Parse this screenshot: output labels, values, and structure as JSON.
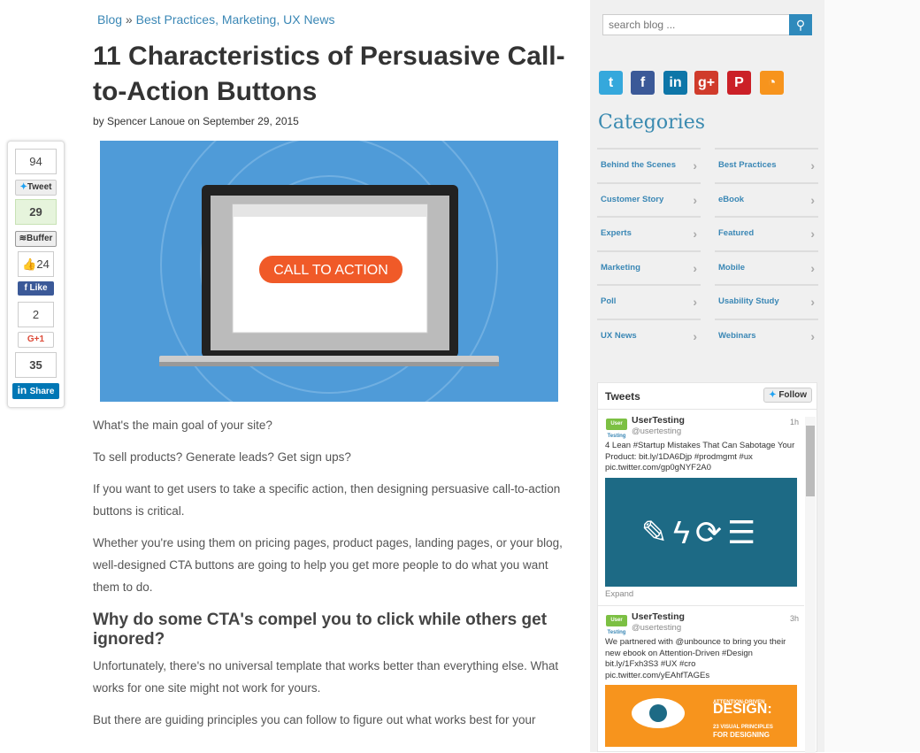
{
  "breadcrumb": {
    "root": "Blog",
    "sep": "»",
    "categories": "Best Practices, Marketing, UX News"
  },
  "article": {
    "title": "11 Characteristics of Persuasive Call-to-Action Buttons",
    "byline": "by Spencer Lanoue on September 29, 2015",
    "hero_cta": "CALL TO ACTION",
    "paragraphs": [
      "What's the main goal of your site?",
      "To sell products? Generate leads? Get sign ups?",
      "If you want to get users to take a specific action, then designing persuasive call-to-action buttons is critical.",
      "Whether you're using them on pricing pages, product pages, landing pages, or your blog, well-designed CTA buttons are going to help you get more people to do what you want them to do."
    ],
    "heading": "Why do some CTA's compel you to click while others get ignored?",
    "paragraphs2": [
      "Unfortunately, there's no universal template that works better than everything else. What works for one site might not work for yours.",
      "But there are guiding principles you can follow to figure out what works best for your"
    ]
  },
  "share": {
    "tweet_count": "94",
    "tweet_label": "Tweet",
    "buffer_count": "29",
    "buffer_label": "Buffer",
    "like_count": "24",
    "like_label": "Like",
    "gplus_count": "2",
    "gplus_label": "G+1",
    "linkedin_count": "35",
    "linkedin_label": "Share"
  },
  "sidebar": {
    "search_placeholder": "search blog ...",
    "social": [
      "twitter",
      "facebook",
      "linkedin",
      "google-plus",
      "pinterest",
      "rss"
    ],
    "categories_title": "Categories",
    "categories": [
      "Behind the Scenes",
      "Best Practices",
      "Customer Story",
      "eBook",
      "Experts",
      "Featured",
      "Marketing",
      "Mobile",
      "Poll",
      "Usability Study",
      "UX News",
      "Webinars"
    ],
    "tweets": {
      "title": "Tweets",
      "follow": "Follow",
      "items": [
        {
          "name": "UserTesting",
          "handle": "@usertesting",
          "time": "1h",
          "text": "4 Lean #Startup Mistakes That Can Sabotage Your Product: bit.ly/1DA6Djp #prodmgmt #ux pic.twitter.com/gp0gNYF2A0",
          "expand": "Expand"
        },
        {
          "name": "UserTesting",
          "handle": "@usertesting",
          "time": "3h",
          "text": "We partnered with @unbounce to bring you their new ebook on Attention-Driven #Design bit.ly/1Fxh3S3 #UX #cro pic.twitter.com/yEAhfTAGEs",
          "image_text": [
            "ATTENTION-DRIVEN",
            "DESIGN:",
            "23 VISUAL PRINCIPLES",
            "FOR DESIGNING"
          ]
        }
      ],
      "logo": [
        "User",
        "Testing"
      ]
    }
  }
}
